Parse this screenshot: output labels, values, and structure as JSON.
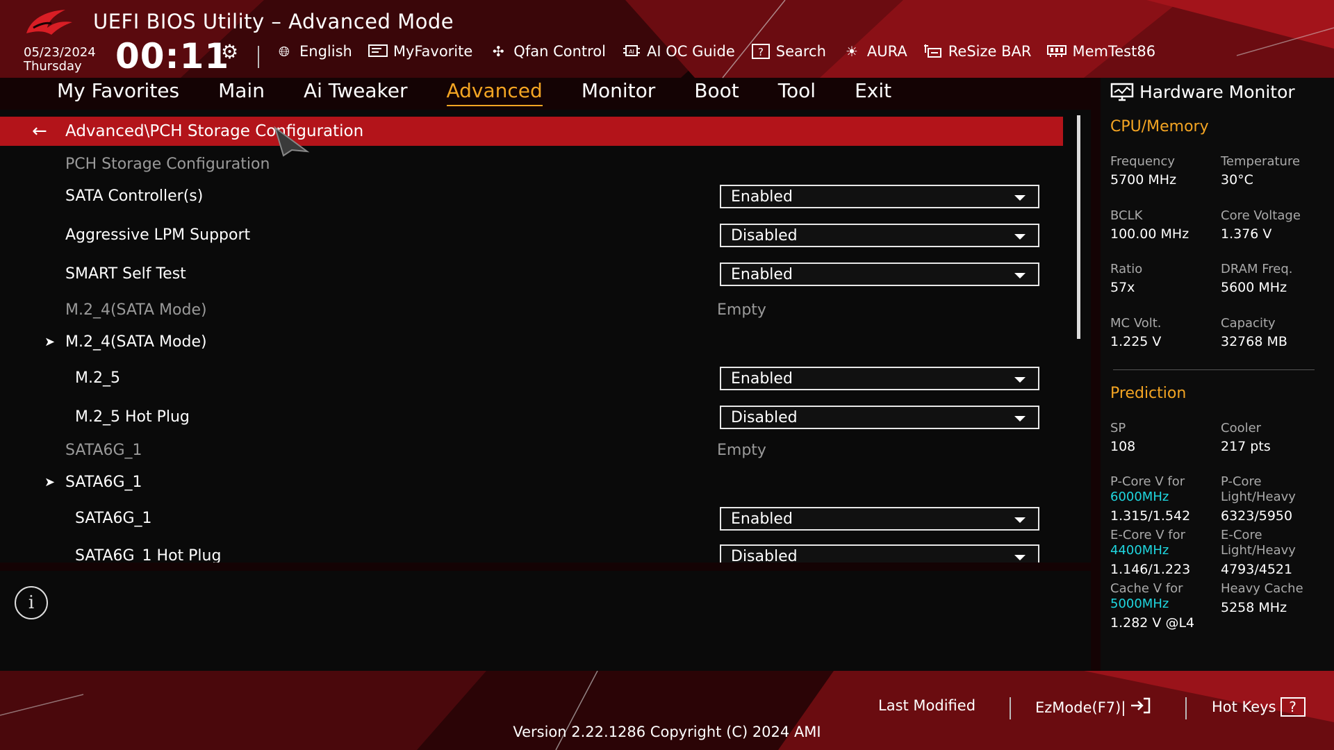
{
  "header": {
    "title": "UEFI BIOS Utility – Advanced Mode",
    "date": "05/23/2024",
    "day": "Thursday",
    "time": "00:11",
    "tools": [
      {
        "label": "English",
        "icon": "globe-icon"
      },
      {
        "label": "MyFavorite",
        "icon": "favorite-icon"
      },
      {
        "label": "Qfan Control",
        "icon": "fan-icon"
      },
      {
        "label": "AI OC Guide",
        "icon": "ai-chip-icon"
      },
      {
        "label": "Search",
        "icon": "help-search-icon"
      },
      {
        "label": "AURA",
        "icon": "aura-light-icon"
      },
      {
        "label": "ReSize BAR",
        "icon": "resize-bar-icon"
      },
      {
        "label": "MemTest86",
        "icon": "memory-icon"
      }
    ]
  },
  "nav": {
    "tabs": [
      "My Favorites",
      "Main",
      "Ai Tweaker",
      "Advanced",
      "Monitor",
      "Boot",
      "Tool",
      "Exit"
    ],
    "active": "Advanced"
  },
  "main": {
    "breadcrumb": "Advanced\\PCH Storage Configuration",
    "rows": [
      {
        "label": "PCH Storage Configuration",
        "type": "heading"
      },
      {
        "label": "SATA Controller(s)",
        "type": "dropdown",
        "value": "Enabled"
      },
      {
        "label": "Aggressive LPM Support",
        "type": "dropdown",
        "value": "Disabled"
      },
      {
        "label": "SMART Self Test",
        "type": "dropdown",
        "value": "Enabled"
      },
      {
        "label": "M.2_4(SATA Mode)",
        "type": "info",
        "value": "Empty"
      },
      {
        "label": "M.2_4(SATA Mode)",
        "type": "submenu"
      },
      {
        "label": "M.2_5",
        "type": "dropdown",
        "value": "Enabled"
      },
      {
        "label": "M.2_5 Hot Plug",
        "type": "dropdown",
        "value": "Disabled"
      },
      {
        "label": "SATA6G_1",
        "type": "info",
        "value": "Empty"
      },
      {
        "label": "SATA6G_1",
        "type": "submenu"
      },
      {
        "label": "SATA6G_1",
        "type": "dropdown",
        "value": "Enabled"
      },
      {
        "label": "SATA6G_1 Hot Plug",
        "type": "dropdown",
        "value": "Disabled"
      }
    ]
  },
  "hardware_monitor": {
    "title": "Hardware Monitor",
    "cpu_memory": {
      "section": "CPU/Memory",
      "frequency_label": "Frequency",
      "frequency": "5700 MHz",
      "temperature_label": "Temperature",
      "temperature": "30°C",
      "bclk_label": "BCLK",
      "bclk": "100.00 MHz",
      "core_voltage_label": "Core Voltage",
      "core_voltage": "1.376 V",
      "ratio_label": "Ratio",
      "ratio": "57x",
      "dram_label": "DRAM Freq.",
      "dram": "5600 MHz",
      "mc_label": "MC Volt.",
      "mc": "1.225 V",
      "capacity_label": "Capacity",
      "capacity": "32768 MB"
    },
    "prediction": {
      "section": "Prediction",
      "sp_label": "SP",
      "sp": "108",
      "cooler_label": "Cooler",
      "cooler": "217 pts",
      "pcore_label": "P-Core V for",
      "pcore_freq": "6000MHz",
      "pcore": "1.315/1.542",
      "pcore_lh_label_1": "P-Core",
      "pcore_lh_label_2": "Light/Heavy",
      "pcore_lh": "6323/5950",
      "ecore_label": "E-Core V for",
      "ecore_freq": "4400MHz",
      "ecore": "1.146/1.223",
      "ecore_lh_label_1": "E-Core",
      "ecore_lh_label_2": "Light/Heavy",
      "ecore_lh": "4793/4521",
      "cache_label": "Cache V for",
      "cache_freq": "5000MHz",
      "cache": "1.282 V @L4",
      "heavy_cache_label": "Heavy Cache",
      "heavy_cache": "5258 MHz"
    }
  },
  "footer": {
    "last_modified": "Last Modified",
    "ezmode": "EzMode(F7)|",
    "hotkeys": "Hot Keys",
    "version": "Version 2.22.1286 Copyright (C) 2024 AMI"
  },
  "colors": {
    "accent": "#f4a523",
    "highlight_bar": "#b3141a",
    "cyan": "#1fd7e0"
  }
}
